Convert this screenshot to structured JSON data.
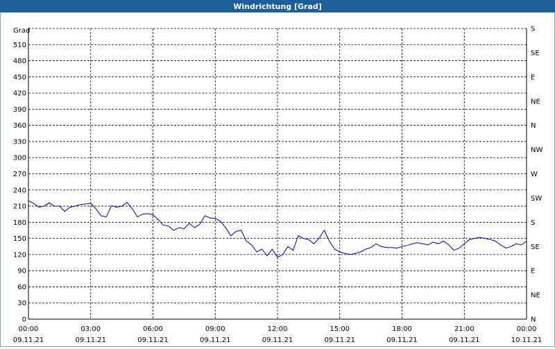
{
  "title": "Windrichtung [Grad]",
  "chart_data": {
    "type": "line",
    "ylabel": "Grad",
    "ylim": [
      0,
      540
    ],
    "yticks": [
      0,
      30,
      60,
      90,
      120,
      150,
      180,
      210,
      240,
      270,
      300,
      330,
      360,
      390,
      420,
      450,
      480,
      510
    ],
    "right_axis_labels": [
      "N",
      "NE",
      "E",
      "SE",
      "S",
      "SW",
      "W",
      "NW",
      "N",
      "NE",
      "E",
      "SE",
      "S"
    ],
    "right_axis_values": [
      0,
      30,
      60,
      90,
      120,
      150,
      180,
      210,
      240,
      270,
      300,
      330,
      360
    ],
    "x_ticks": [
      {
        "time": "00:00",
        "date": "09.11.21"
      },
      {
        "time": "03:00",
        "date": "09.11.21"
      },
      {
        "time": "06:00",
        "date": "09.11.21"
      },
      {
        "time": "09:00",
        "date": "09.11.21"
      },
      {
        "time": "12:00",
        "date": "09.11.21"
      },
      {
        "time": "15:00",
        "date": "09.11.21"
      },
      {
        "time": "18:00",
        "date": "09.11.21"
      },
      {
        "time": "21:00",
        "date": "09.11.21"
      },
      {
        "time": "00:00",
        "date": "10.11.21"
      }
    ],
    "grid": true,
    "line_color": "#0000aa",
    "series": [
      {
        "x_hours": [
          0,
          0.25,
          0.5,
          0.75,
          1,
          1.25,
          1.5,
          1.75,
          2,
          2.25,
          2.5,
          2.75,
          3,
          3.25,
          3.5,
          3.75,
          4,
          4.25,
          4.5,
          4.75,
          5,
          5.25,
          5.5,
          5.75,
          6,
          6.25,
          6.5,
          6.75,
          7,
          7.25,
          7.5,
          7.75,
          8,
          8.25,
          8.5,
          8.75,
          9,
          9.25,
          9.5,
          9.75,
          10,
          10.25,
          10.5,
          10.75,
          11,
          11.25,
          11.5,
          11.75,
          12,
          12.25,
          12.5,
          12.75,
          13,
          13.25,
          13.5,
          13.75,
          14,
          14.25,
          14.5,
          14.75,
          15,
          15.25,
          15.5,
          15.75,
          16,
          16.25,
          16.5,
          16.75,
          17,
          17.25,
          17.5,
          17.75,
          18,
          18.25,
          18.5,
          18.75,
          19,
          19.25,
          19.5,
          19.75,
          20,
          20.25,
          20.5,
          20.75,
          21,
          21.25,
          21.5,
          21.75,
          22,
          22.25,
          22.5,
          22.75,
          23,
          23.25,
          23.5,
          23.75,
          24
        ],
        "values": [
          220,
          215,
          208,
          210,
          216,
          210,
          210,
          200,
          208,
          210,
          213,
          214,
          215,
          205,
          192,
          190,
          211,
          208,
          210,
          217,
          205,
          190,
          195,
          196,
          194,
          185,
          175,
          173,
          165,
          170,
          168,
          178,
          170,
          176,
          192,
          188,
          187,
          182,
          170,
          155,
          163,
          165,
          145,
          138,
          125,
          130,
          118,
          130,
          115,
          120,
          135,
          128,
          155,
          150,
          148,
          140,
          150,
          165,
          145,
          130,
          125,
          122,
          120,
          122,
          125,
          130,
          133,
          140,
          135,
          133,
          133,
          132,
          135,
          137,
          140,
          142,
          140,
          138,
          143,
          140,
          145,
          138,
          128,
          132,
          140,
          148,
          150,
          152,
          150,
          148,
          145,
          138,
          132,
          135,
          140,
          138,
          145
        ]
      }
    ]
  }
}
